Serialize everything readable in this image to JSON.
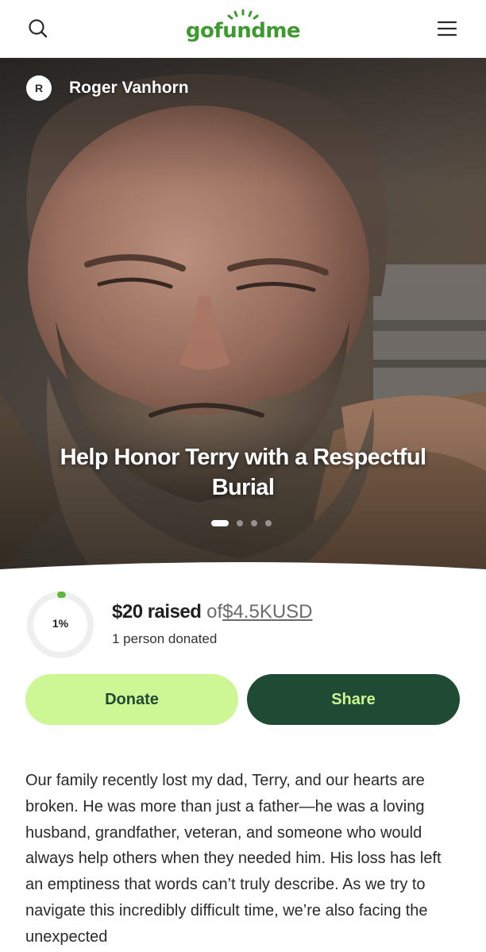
{
  "header": {
    "logo_text": "gofundme",
    "search_icon": "search-icon",
    "menu_icon": "hamburger-menu-icon"
  },
  "hero": {
    "organizer_initial": "R",
    "organizer_name": "Roger Vanhorn",
    "title": "Help Honor Terry with a Respectful Burial",
    "carousel_total": 4,
    "carousel_active": 1
  },
  "progress": {
    "percent_label": "1%",
    "percent_value": 0.01,
    "raised_amount": "$20 raised",
    "of_label": "of",
    "goal": "$4.5KUSD",
    "donors": "1 person donated"
  },
  "actions": {
    "donate_label": "Donate",
    "share_label": "Share"
  },
  "story": {
    "text": "Our family recently lost my dad, Terry, and our hearts are broken. He was more than just a father—he was a loving husband, grandfather, veteran, and someone who would always help others when they needed him. His loss has left an emptiness that words can’t truly describe. As we try to navigate this incredibly difficult time, we’re also facing the unexpected"
  },
  "colors": {
    "brand_green": "#3d9a2f",
    "donate_bg": "#cdf794",
    "share_bg": "#1f4a33",
    "progress_green": "#5bb83a"
  }
}
